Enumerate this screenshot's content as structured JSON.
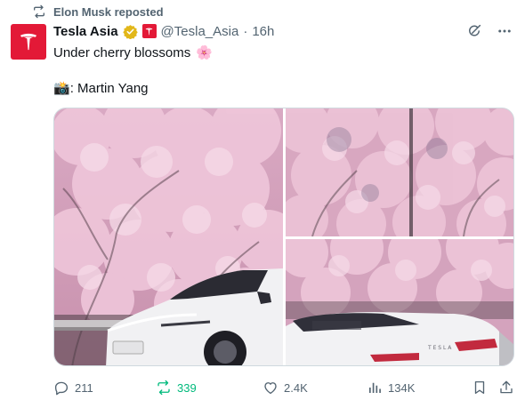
{
  "repost_bar": {
    "text": "Elon Musk reposted",
    "icon": "repost-icon"
  },
  "author": {
    "avatar_icon": "tesla-logo-icon",
    "display_name": "Tesla Asia",
    "verified_icon": "gold-checkmark-badge-icon",
    "affiliate_icon": "tesla-affiliate-badge-icon",
    "handle": "@Tesla_Asia",
    "separator": "·",
    "time": "16h"
  },
  "header_actions": {
    "grok_icon": "grok-icon",
    "more_icon": "more-dots-icon"
  },
  "tweet": {
    "line1": "Under cherry blossoms",
    "line1_glyph": "🌸",
    "line2_glyph": "📸",
    "line2": ": Martin Yang"
  },
  "media": {
    "photos": [
      {
        "name": "cherry-blossom-white-car-photo-left"
      },
      {
        "name": "cherry-blossom-trees-photo-top-right"
      },
      {
        "name": "cherry-blossom-car-rear-photo-bottom-right"
      }
    ],
    "car_rear_lettering": "T E S L A"
  },
  "actions": {
    "reply": {
      "icon": "reply-icon",
      "count": "211"
    },
    "repost": {
      "icon": "repost-icon",
      "count": "339"
    },
    "like": {
      "icon": "heart-icon",
      "count": "2.4K"
    },
    "views": {
      "icon": "views-chart-icon",
      "count": "134K"
    },
    "bookmark": {
      "icon": "bookmark-icon"
    },
    "share": {
      "icon": "share-icon"
    }
  },
  "colors": {
    "repost_green": "#00ba7c",
    "muted_text": "#536471",
    "tesla_red": "#e31937",
    "verified_gold": "#e2b719",
    "blossom_pink": "#e9b8cf"
  }
}
